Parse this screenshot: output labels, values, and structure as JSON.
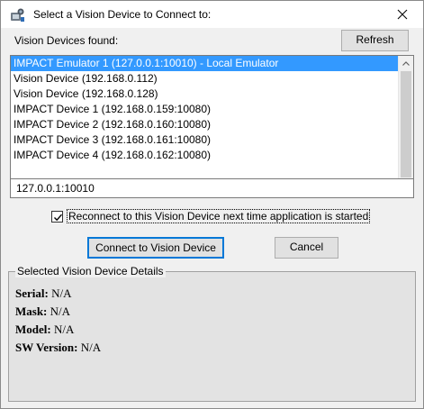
{
  "window": {
    "title": "Select a Vision Device to Connect to:",
    "icon": "vision-app-icon",
    "close_icon": "close-icon"
  },
  "devices": {
    "label": "Vision Devices found:",
    "refresh_label": "Refresh",
    "items": [
      "IMPACT Emulator 1   (127.0.0.1:10010) - Local Emulator",
      "Vision Device   (192.168.0.112)",
      "Vision Device   (192.168.0.128)",
      "IMPACT Device 1   (192.168.0.159:10080)",
      "IMPACT Device 2   (192.168.0.160:10080)",
      "IMPACT Device 3   (192.168.0.161:10080)",
      "IMPACT Device 4   (192.168.0.162:10080)"
    ],
    "selected_index": 0
  },
  "address": {
    "value": "127.0.0.1:10010"
  },
  "reconnect": {
    "label": "Reconnect to this Vision Device next time application is started",
    "checked": true
  },
  "actions": {
    "connect_label": "Connect to Vision Device",
    "cancel_label": "Cancel"
  },
  "details": {
    "legend": "Selected Vision Device Details",
    "serial_key": "Serial:",
    "serial_value": " N/A",
    "mask_key": "Mask:",
    "mask_value": " N/A",
    "model_key": "Model:",
    "model_value": " N/A",
    "sw_key": "SW Version:",
    "sw_value": " N/A"
  },
  "colors": {
    "selection": "#3399ff",
    "default_button_border": "#0078d7"
  }
}
